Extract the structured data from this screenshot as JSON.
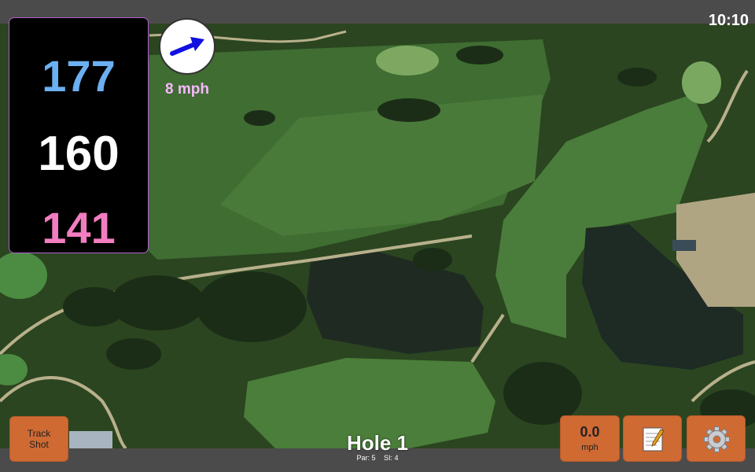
{
  "status": {
    "time": "10:10"
  },
  "distances": {
    "back": "177",
    "middle": "160",
    "front": "141"
  },
  "wind": {
    "speed_label": "8 mph",
    "icon": "wind-arrow-icon"
  },
  "hole": {
    "title": "Hole 1",
    "par_label": "Par: 5",
    "si_label": "SI: 4"
  },
  "buttons": {
    "track_shot_line1": "Track",
    "track_shot_line2": "Shot",
    "speed_value": "0.0",
    "speed_unit": "mph",
    "notes_icon": "notepad-icon",
    "settings_icon": "gear-icon"
  },
  "colors": {
    "back": "#6bb0f0",
    "middle": "#ffffff",
    "front": "#f27dc0",
    "button": "#cf6a33",
    "wind_text": "#f7b8ff",
    "panel_border": "#b25fd1"
  }
}
